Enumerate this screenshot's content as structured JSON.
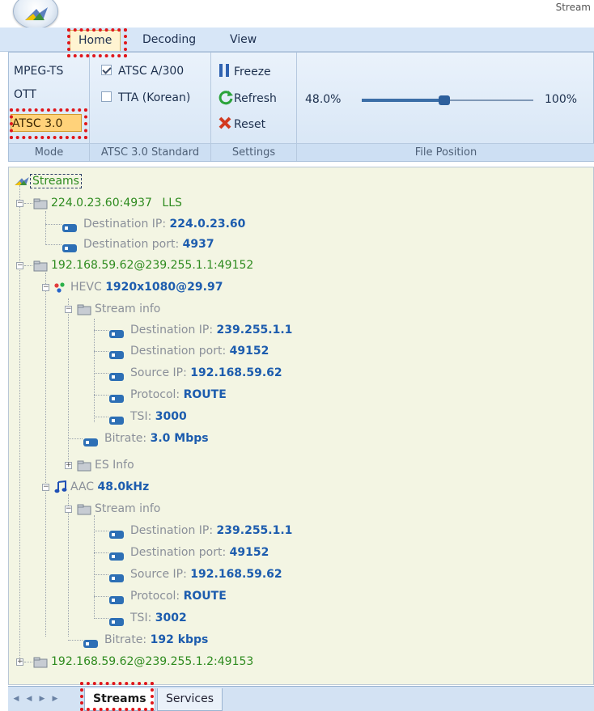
{
  "window": {
    "title_fragment": "Stream"
  },
  "ribbon_tabs": [
    {
      "label": "Home",
      "active": true
    },
    {
      "label": "Decoding",
      "active": false
    },
    {
      "label": "View",
      "active": false
    }
  ],
  "mode_group": {
    "label": "Mode",
    "options": [
      {
        "label": "MPEG-TS",
        "selected": false
      },
      {
        "label": "OTT",
        "selected": false
      },
      {
        "label": "ATSC 3.0",
        "selected": true
      }
    ]
  },
  "standard_group": {
    "label": "ATSC 3.0 Standard",
    "options": [
      {
        "label": "ATSC A/300",
        "checked": true
      },
      {
        "label": "TTA (Korean)",
        "checked": false
      }
    ]
  },
  "settings_group": {
    "label": "Settings",
    "buttons": [
      {
        "label": "Freeze",
        "icon": "pause-icon"
      },
      {
        "label": "Refresh",
        "icon": "refresh-icon"
      },
      {
        "label": "Reset",
        "icon": "reset-x-icon"
      }
    ]
  },
  "file_position_group": {
    "label": "File Position",
    "current": "48.0%",
    "max": "100%",
    "value_fraction": 0.48
  },
  "tree": {
    "root": "Streams",
    "s1_label": "224.0.23.60:4937",
    "s1_tag": "LLS",
    "s1_dest_ip_label": "Destination IP:",
    "s1_dest_ip_value": "224.0.23.60",
    "s1_dest_port_label": "Destination port:",
    "s1_dest_port_value": "4937",
    "s2_label": "192.168.59.62@239.255.1.1:49152",
    "hevc_label": "HEVC",
    "hevc_value": "1920x1080@29.97",
    "hevc_streaminfo": "Stream info",
    "hevc_dest_ip_label": "Destination IP:",
    "hevc_dest_ip_value": "239.255.1.1",
    "hevc_dest_port_label": "Destination port:",
    "hevc_dest_port_value": "49152",
    "hevc_src_ip_label": "Source IP:",
    "hevc_src_ip_value": "192.168.59.62",
    "hevc_protocol_label": "Protocol:",
    "hevc_protocol_value": "ROUTE",
    "hevc_tsi_label": "TSI:",
    "hevc_tsi_value": "3000",
    "hevc_bitrate_label": "Bitrate:",
    "hevc_bitrate_value": "3.0 Mbps",
    "hevc_esinfo": "ES Info",
    "aac_label": "AAC",
    "aac_value": "48.0kHz",
    "aac_streaminfo": "Stream info",
    "aac_dest_ip_label": "Destination IP:",
    "aac_dest_ip_value": "239.255.1.1",
    "aac_dest_port_label": "Destination port:",
    "aac_dest_port_value": "49152",
    "aac_src_ip_label": "Source IP:",
    "aac_src_ip_value": "192.168.59.62",
    "aac_protocol_label": "Protocol:",
    "aac_protocol_value": "ROUTE",
    "aac_tsi_label": "TSI:",
    "aac_tsi_value": "3002",
    "aac_bitrate_label": "Bitrate:",
    "aac_bitrate_value": "192 kbps",
    "s3_label": "192.168.59.62@239.255.1.2:49153"
  },
  "bottom_tabs": [
    {
      "label": "Streams",
      "active": true
    },
    {
      "label": "Services",
      "active": false
    }
  ],
  "colors": {
    "accent_green": "#2e8b1f",
    "value_blue": "#1c5cae",
    "highlight_red": "#e0161b"
  }
}
